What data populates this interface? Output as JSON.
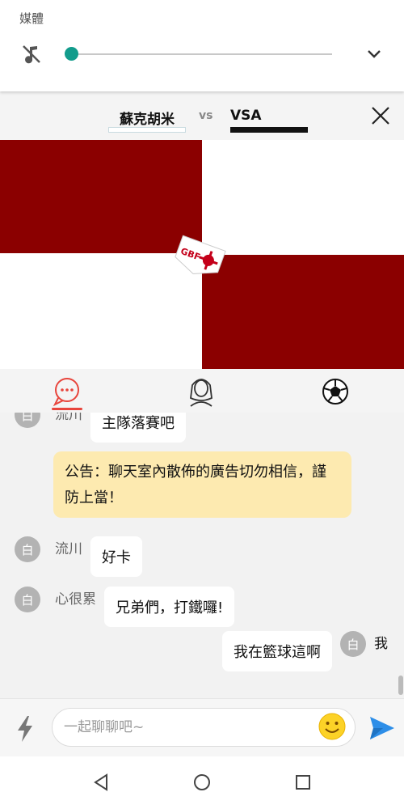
{
  "media": {
    "label": "媒體",
    "volume_level_percent": 0,
    "icons": {
      "mute": "music-off-icon",
      "expand": "chevron-down-icon"
    }
  },
  "match": {
    "team_a": "蘇克胡米",
    "vs": "vs",
    "team_b": "VSA",
    "close_icon": "close-icon"
  },
  "banner": {
    "colors": {
      "dark": "#8b0000",
      "light": "#ffffff"
    },
    "logo_text": "GBF"
  },
  "tabs": [
    {
      "icon": "chat-bubble-icon",
      "active": true
    },
    {
      "icon": "person-icon",
      "active": false
    },
    {
      "icon": "soccer-ball-icon",
      "active": false
    }
  ],
  "chat": {
    "partial_message": {
      "avatar": "白",
      "nick": "流川",
      "text": "主隊落賽吧"
    },
    "notice": "公告：聊天室內散佈的廣告切勿相信，謹防上當！",
    "messages": [
      {
        "avatar": "白",
        "nick": "流川",
        "text": "好卡"
      },
      {
        "avatar": "白",
        "nick": "心很累",
        "text": "兄弟們，打鐵囉!"
      }
    ],
    "self_message": {
      "avatar": "白",
      "nick": "我",
      "text": "我在籃球這啊"
    }
  },
  "input": {
    "placeholder": "一起聊聊吧~",
    "icons": {
      "quick": "lightning-icon",
      "emoji": "emoji-icon",
      "send": "send-icon"
    }
  },
  "system_nav": {
    "icons": [
      "back-icon",
      "home-icon",
      "recents-icon"
    ]
  },
  "colors": {
    "accent_teal": "#129c8c",
    "tab_indicator": "#e8453c",
    "notice_bg": "#fdeab0",
    "send_blue": "#2d8ee8"
  }
}
